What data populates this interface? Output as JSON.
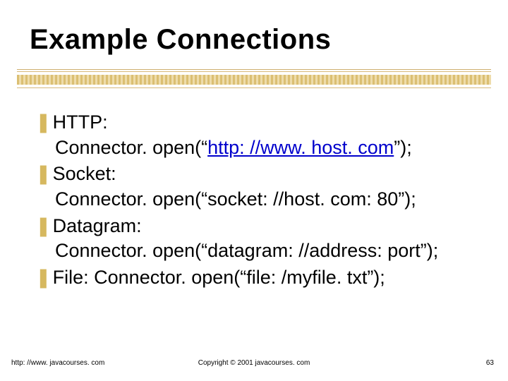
{
  "title": "Example Connections",
  "bullet_char": "❚",
  "items": [
    {
      "label": "HTTP:",
      "code_pre": "Connector. open(“",
      "code_link": "http: //www. host. com",
      "code_post": "”);"
    },
    {
      "label": "Socket:",
      "code": "Connector. open(“socket: //host. com: 80”);"
    },
    {
      "label": "Datagram:",
      "code": "Connector. open(“datagram: //address: port”);"
    },
    {
      "label": "File:",
      "code_inline": "Connector. open(“file: /myfile. txt”);"
    }
  ],
  "footer": {
    "left": "http: //www. javacourses. com",
    "center": "Copyright © 2001 javacourses. com",
    "right": "63"
  }
}
